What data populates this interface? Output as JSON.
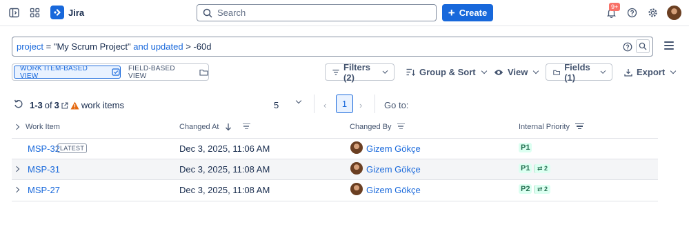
{
  "app": {
    "name": "Jira"
  },
  "search": {
    "placeholder": "Search"
  },
  "create_label": "Create",
  "notifications": {
    "badge": "9+"
  },
  "jql": {
    "parts": [
      {
        "text": "project",
        "kind": "kw"
      },
      {
        "text": " = \"My Scrum Project\" ",
        "kind": "op"
      },
      {
        "text": "and",
        "kind": "kw"
      },
      {
        "text": " ",
        "kind": "op"
      },
      {
        "text": "updated",
        "kind": "kw"
      },
      {
        "text": " > -60d",
        "kind": "op"
      }
    ]
  },
  "views": {
    "active": "WORK ITEM-BASED VIEW",
    "inactive": "FIELD-BASED VIEW"
  },
  "toolbar": {
    "filters": "Filters (2)",
    "group_sort": "Group & Sort",
    "view": "View",
    "fields": "Fields (1)",
    "export": "Export"
  },
  "results": {
    "range": "1-3",
    "of": "of",
    "total": "3",
    "suffix": "work items",
    "page_size": "5",
    "current_page": "1",
    "goto": "Go to:"
  },
  "columns": {
    "work_item": "Work Item",
    "changed_at": "Changed At",
    "changed_by": "Changed By",
    "internal_priority": "Internal Priority"
  },
  "rows": [
    {
      "key": "MSP-32",
      "tag": "LATEST",
      "changed_at": "Dec 3, 2025, 11:06 AM",
      "changed_by": "Gizem Gökçe",
      "priority": "P1",
      "change_count": ""
    },
    {
      "key": "MSP-31",
      "tag": "",
      "changed_at": "Dec 3, 2025, 11:08 AM",
      "changed_by": "Gizem Gökçe",
      "priority": "P1",
      "change_count": "2"
    },
    {
      "key": "MSP-27",
      "tag": "",
      "changed_at": "Dec 3, 2025, 11:08 AM",
      "changed_by": "Gizem Gökçe",
      "priority": "P2",
      "change_count": "2"
    }
  ],
  "colors": {
    "brand": "#1868db",
    "lozenge_bg": "#dcfff1",
    "lozenge_fg": "#216e4e",
    "warning": "#e56910",
    "badge": "#f87168"
  }
}
